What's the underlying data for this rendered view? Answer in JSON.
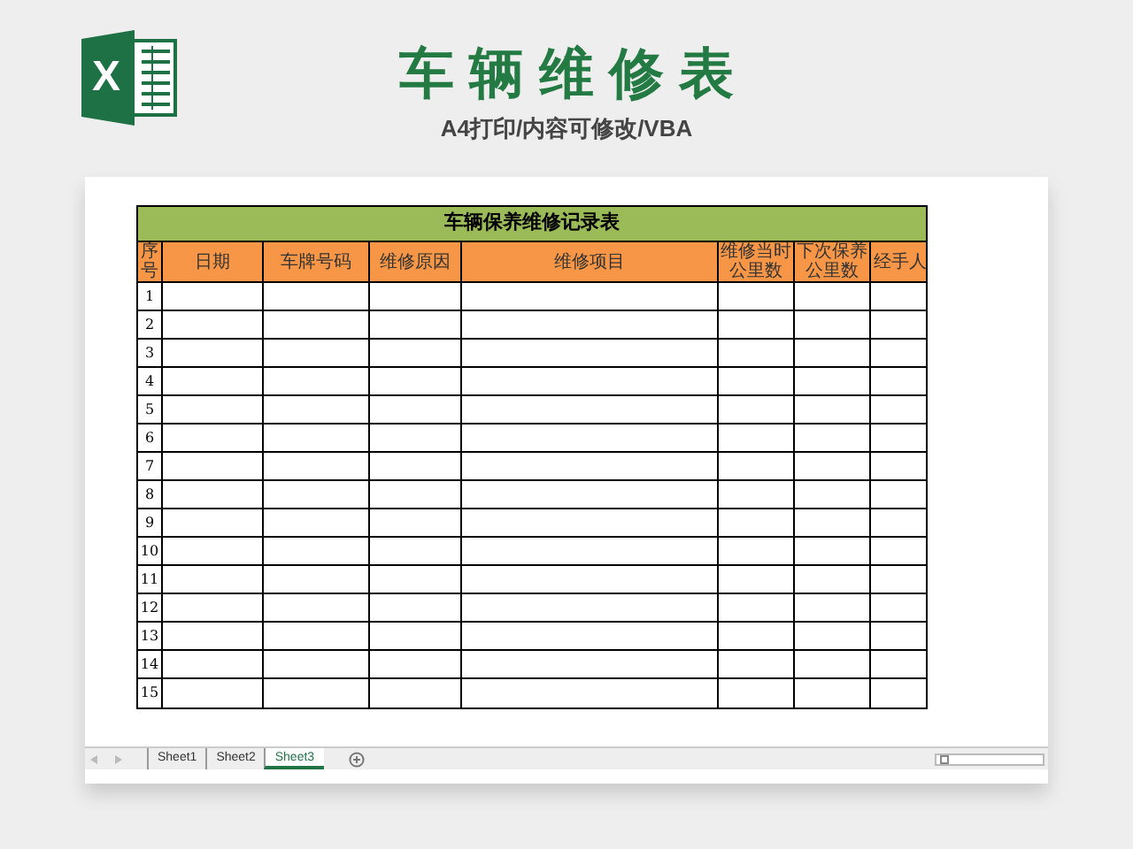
{
  "logo": {
    "letter": "X"
  },
  "title": "车 辆 维 修 表",
  "subtitle": "A4打印/内容可修改/VBA",
  "sheet": {
    "title": "车辆保养维修记录表",
    "columns": [
      "序号",
      "日期",
      "车牌号码",
      "维修原因",
      "维修项目",
      "维修当时公里数",
      "下次保养公里数",
      "经手人"
    ],
    "rows": [
      "1",
      "2",
      "3",
      "4",
      "5",
      "6",
      "7",
      "8",
      "9",
      "10",
      "11",
      "12",
      "13",
      "14",
      "15"
    ]
  },
  "tabs": [
    {
      "label": "Sheet1",
      "selected": false
    },
    {
      "label": "Sheet2",
      "selected": false
    },
    {
      "label": "Sheet3",
      "selected": true
    }
  ]
}
